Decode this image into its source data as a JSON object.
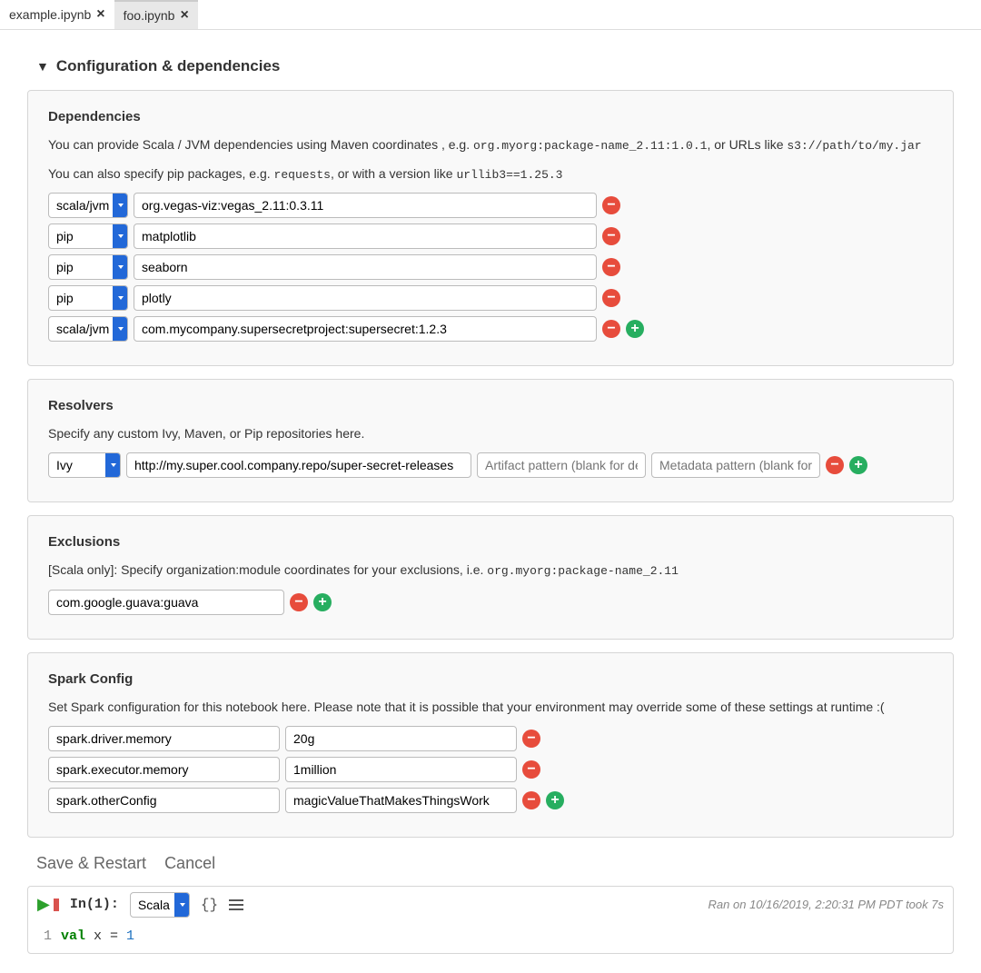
{
  "tabs": [
    {
      "name": "example.ipynb",
      "active": false
    },
    {
      "name": "foo.ipynb",
      "active": true
    }
  ],
  "section_title": "Configuration & dependencies",
  "dependencies": {
    "heading": "Dependencies",
    "desc_pre": "You can provide Scala / JVM dependencies using Maven coordinates , e.g. ",
    "desc_code1": "org.myorg:package-name_2.11:1.0.1",
    "desc_mid": ", or URLs like ",
    "desc_code2": "s3://path/to/my.jar",
    "desc2_pre": "You can also specify pip packages, e.g. ",
    "desc2_code1": "requests",
    "desc2_mid": ", or with a version like ",
    "desc2_code2": "urllib3==1.25.3",
    "type_options": {
      "scala": "scala/jvm",
      "pip": "pip"
    },
    "rows": [
      {
        "type": "scala/jvm",
        "value": "org.vegas-viz:vegas_2.11:0.3.11"
      },
      {
        "type": "pip",
        "value": "matplotlib"
      },
      {
        "type": "pip",
        "value": "seaborn"
      },
      {
        "type": "pip",
        "value": "plotly"
      },
      {
        "type": "scala/jvm",
        "value": "com.mycompany.supersecretproject:supersecret:1.2.3"
      }
    ]
  },
  "resolvers": {
    "heading": "Resolvers",
    "desc": "Specify any custom Ivy, Maven, or Pip repositories here.",
    "type_option": "Ivy",
    "rows": [
      {
        "type": "Ivy",
        "url": "http://my.super.cool.company.repo/super-secret-releases",
        "artifact": "",
        "metadata": ""
      }
    ],
    "artifact_placeholder": "Artifact pattern (blank for default)",
    "metadata_placeholder": "Metadata pattern (blank for default)"
  },
  "exclusions": {
    "heading": "Exclusions",
    "desc_pre": "[Scala only]: Specify organization:module coordinates for your exclusions, i.e. ",
    "desc_code": "org.myorg:package-name_2.11",
    "rows": [
      {
        "value": "com.google.guava:guava"
      }
    ]
  },
  "spark": {
    "heading": "Spark Config",
    "desc": "Set Spark configuration for this notebook here. Please note that it is possible that your environment may override some of these settings at runtime :(",
    "rows": [
      {
        "key": "spark.driver.memory",
        "value": "20g"
      },
      {
        "key": "spark.executor.memory",
        "value": "1million"
      },
      {
        "key": "spark.otherConfig",
        "value": "magicValueThatMakesThingsWork"
      }
    ]
  },
  "actions": {
    "save": "Save & Restart",
    "cancel": "Cancel"
  },
  "cell": {
    "in_label": "In(1):",
    "kernel": "Scala",
    "status": "Ran on 10/16/2019, 2:20:31 PM PDT took 7s",
    "line_no": "1",
    "code_kw": "val",
    "code_rest": " x = ",
    "code_num": "1"
  }
}
